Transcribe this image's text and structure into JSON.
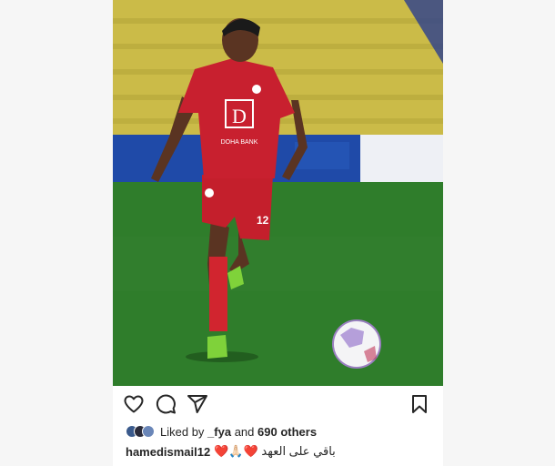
{
  "post": {
    "photo_alt": "",
    "actions": {
      "like_icon": "heart-outline-icon",
      "comment_icon": "comment-bubble-icon",
      "share_icon": "paper-plane-icon",
      "save_icon": "bookmark-icon"
    },
    "likes": {
      "prefix": "Liked by",
      "user": "_fya",
      "connector": "and",
      "others": "690 others"
    },
    "caption": {
      "username": "hamedismail12",
      "text": "باقي على العهد ❤️🙏🏻❤️"
    },
    "sponsor_text": "DOHA BANK",
    "shirt_number": "12"
  },
  "colors": {
    "kit_red": "#c8202f",
    "pitch_green": "#2f7d2b",
    "stand_yellow": "#d4c24a",
    "boot_green": "#8ee03a"
  }
}
